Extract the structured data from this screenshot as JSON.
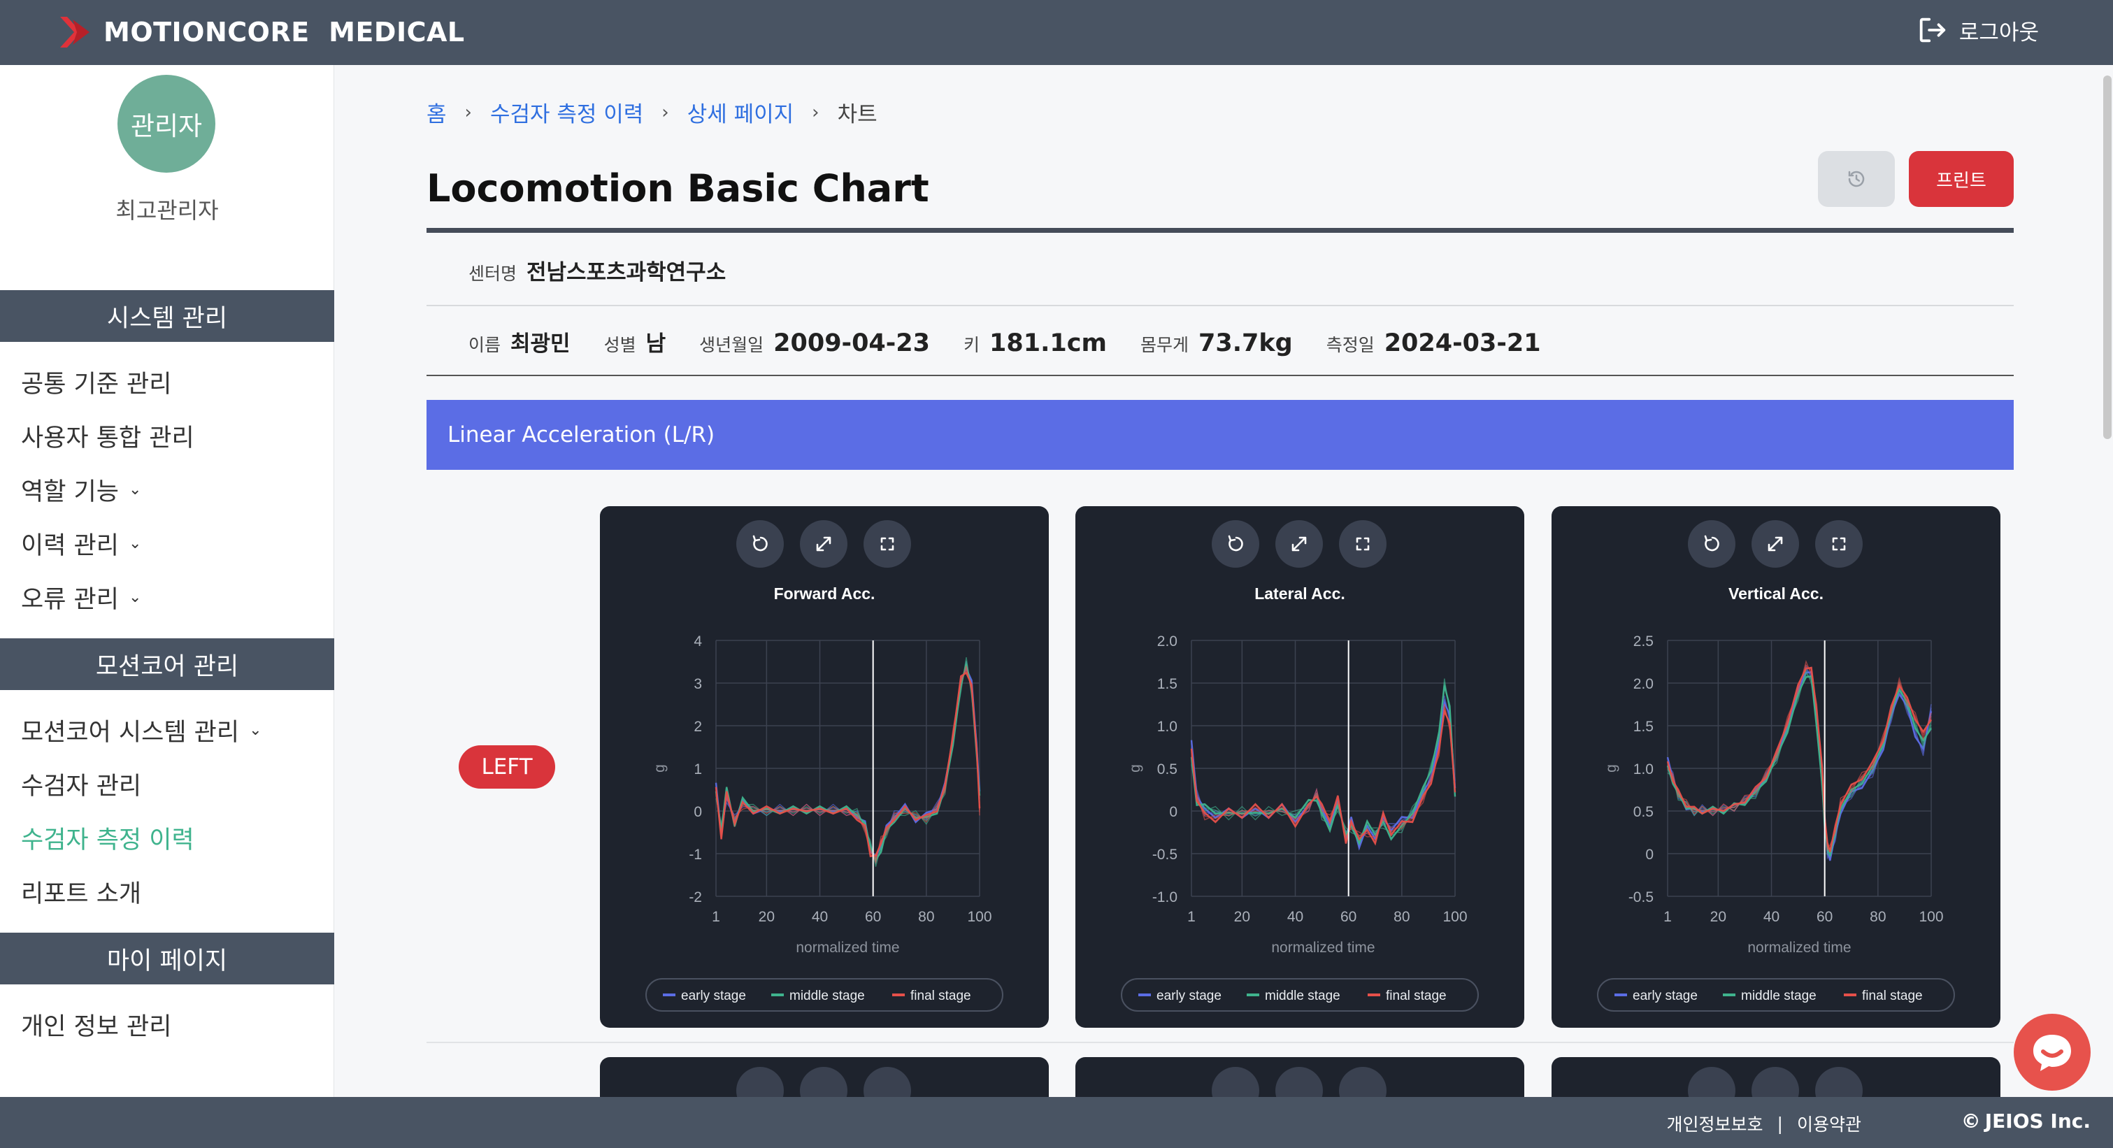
{
  "brand": {
    "name": "MOTIONCORE  MEDICAL"
  },
  "header": {
    "logout_label": "로그아웃"
  },
  "user": {
    "avatar_text": "관리자",
    "role": "최고관리자"
  },
  "sidebar": {
    "sections": [
      {
        "title": "시스템 관리",
        "items": [
          {
            "label": "공통 기준 관리",
            "has_submenu": false
          },
          {
            "label": "사용자 통합 관리",
            "has_submenu": false
          },
          {
            "label": "역할 기능",
            "has_submenu": true
          },
          {
            "label": "이력 관리",
            "has_submenu": true
          },
          {
            "label": "오류 관리",
            "has_submenu": true
          }
        ]
      },
      {
        "title": "모션코어 관리",
        "items": [
          {
            "label": "모션코어 시스템 관리",
            "has_submenu": true
          },
          {
            "label": "수검자 관리",
            "has_submenu": false
          },
          {
            "label": "수검자 측정 이력",
            "has_submenu": false,
            "active": true
          },
          {
            "label": "리포트 소개",
            "has_submenu": false
          }
        ]
      },
      {
        "title": "마이 페이지",
        "items": [
          {
            "label": "개인 정보 관리",
            "has_submenu": false
          }
        ]
      }
    ]
  },
  "breadcrumb": {
    "items": [
      "홈",
      "수검자 측정 이력",
      "상세 페이지"
    ],
    "current": "차트"
  },
  "page": {
    "title": "Locomotion Basic Chart",
    "print_label": "프린트"
  },
  "info": {
    "center_label": "센터명",
    "center_value": "전남스포츠과학연구소",
    "name_label": "이름",
    "name_value": "최광민",
    "sex_label": "성별",
    "sex_value": "남",
    "birth_label": "생년월일",
    "birth_value": "2009-04-23",
    "height_label": "키",
    "height_value": "181.1cm",
    "weight_label": "몸무게",
    "weight_value": "73.7kg",
    "date_label": "측정일",
    "date_value": "2024-03-21"
  },
  "section": {
    "title": "Linear Acceleration (L/R)",
    "side_badge": "LEFT"
  },
  "colors": {
    "early": "#5b6de5",
    "middle": "#3fb38d",
    "final": "#e6504a",
    "card_bg": "#1e232d",
    "accent_red": "#d9343b",
    "header_bg": "#495463"
  },
  "chart_data": [
    {
      "type": "line",
      "title": "Forward Acc.",
      "xlabel": "normalized time",
      "ylabel": "g",
      "xlim": [
        1,
        100
      ],
      "ylim": [
        -2,
        4
      ],
      "x_ticks": [
        1,
        20,
        40,
        60,
        80,
        100
      ],
      "y_ticks": [
        -2,
        -1,
        0,
        1,
        2,
        3,
        4
      ],
      "grid": true,
      "legend": "bottom",
      "marker_x": 60,
      "x": [
        1,
        3,
        5,
        8,
        11,
        15,
        20,
        25,
        30,
        35,
        40,
        45,
        50,
        54,
        57,
        59,
        61,
        63,
        65,
        68,
        72,
        76,
        80,
        84,
        87,
        90,
        93,
        95,
        97,
        99,
        100
      ],
      "series": [
        {
          "name": "early stage",
          "values": [
            0.6,
            -0.5,
            0.3,
            -0.2,
            0.2,
            0.0,
            0.0,
            0.05,
            0.0,
            0.05,
            0.0,
            0.05,
            0.0,
            -0.1,
            -0.3,
            -0.9,
            -1.1,
            -0.8,
            -0.4,
            -0.1,
            0.1,
            -0.2,
            -0.1,
            0.1,
            0.6,
            1.7,
            3.0,
            3.4,
            3.0,
            1.5,
            0.4
          ]
        },
        {
          "name": "middle stage",
          "values": [
            0.4,
            -0.4,
            0.5,
            -0.3,
            0.25,
            0.05,
            0.0,
            0.0,
            0.05,
            0.0,
            0.05,
            0.0,
            0.05,
            -0.05,
            -0.35,
            -0.8,
            -1.2,
            -0.9,
            -0.5,
            -0.2,
            0.0,
            -0.1,
            -0.2,
            0.0,
            0.5,
            1.6,
            2.9,
            3.5,
            2.8,
            1.3,
            0.3
          ]
        },
        {
          "name": "final stage",
          "values": [
            0.5,
            -0.6,
            0.4,
            -0.25,
            0.15,
            0.0,
            0.05,
            0.0,
            0.0,
            0.05,
            0.0,
            0.0,
            0.0,
            -0.15,
            -0.4,
            -1.0,
            -1.1,
            -0.7,
            -0.45,
            -0.15,
            0.05,
            -0.15,
            -0.15,
            0.05,
            0.55,
            1.8,
            3.1,
            3.3,
            2.9,
            1.4,
            0.0
          ]
        }
      ]
    },
    {
      "type": "line",
      "title": "Lateral Acc.",
      "xlabel": "normalized time",
      "ylabel": "g",
      "xlim": [
        1,
        100
      ],
      "ylim": [
        -1.0,
        2.0
      ],
      "x_ticks": [
        1,
        20,
        40,
        60,
        80,
        100
      ],
      "y_ticks": [
        -1.0,
        -0.5,
        0,
        0.5,
        1.0,
        1.5,
        2.0
      ],
      "grid": true,
      "legend": "bottom",
      "marker_x": 60,
      "x": [
        1,
        3,
        6,
        10,
        15,
        20,
        25,
        30,
        35,
        40,
        45,
        48,
        50,
        53,
        56,
        59,
        61,
        64,
        67,
        70,
        73,
        76,
        80,
        84,
        88,
        91,
        94,
        96,
        98,
        100
      ],
      "series": [
        {
          "name": "early stage",
          "values": [
            0.8,
            0.2,
            0.0,
            -0.05,
            0.0,
            -0.05,
            0.0,
            -0.05,
            0.05,
            -0.1,
            0.05,
            0.2,
            0.0,
            -0.15,
            0.1,
            -0.3,
            -0.1,
            -0.4,
            -0.2,
            -0.3,
            -0.1,
            -0.2,
            -0.1,
            -0.05,
            0.2,
            0.4,
            0.8,
            1.3,
            1.1,
            0.3
          ]
        },
        {
          "name": "middle stage",
          "values": [
            0.6,
            0.1,
            0.05,
            0.0,
            -0.05,
            0.0,
            -0.05,
            0.0,
            0.0,
            -0.05,
            0.1,
            0.15,
            -0.05,
            -0.2,
            0.05,
            -0.25,
            -0.2,
            -0.35,
            -0.15,
            -0.25,
            -0.15,
            -0.3,
            -0.2,
            0.0,
            0.25,
            0.5,
            0.9,
            1.5,
            1.2,
            0.2
          ]
        },
        {
          "name": "final stage",
          "values": [
            0.7,
            0.15,
            -0.05,
            -0.1,
            0.0,
            -0.05,
            0.05,
            -0.05,
            0.05,
            -0.15,
            0.05,
            0.2,
            0.05,
            -0.1,
            0.15,
            -0.35,
            -0.15,
            -0.3,
            -0.25,
            -0.35,
            -0.05,
            -0.25,
            -0.15,
            -0.1,
            0.15,
            0.35,
            0.7,
            1.2,
            1.0,
            0.25
          ]
        }
      ]
    },
    {
      "type": "line",
      "title": "Vertical Acc.",
      "xlabel": "normalized time",
      "ylabel": "g",
      "xlim": [
        1,
        100
      ],
      "ylim": [
        -0.5,
        2.5
      ],
      "x_ticks": [
        1,
        20,
        40,
        60,
        80,
        100
      ],
      "y_ticks": [
        -0.5,
        0,
        0.5,
        1.0,
        1.5,
        2.0,
        2.5
      ],
      "grid": true,
      "legend": "bottom",
      "marker_x": 60,
      "x": [
        1,
        3,
        5,
        8,
        11,
        14,
        18,
        22,
        26,
        30,
        34,
        38,
        42,
        46,
        50,
        53,
        55,
        57,
        59,
        60,
        61,
        62,
        64,
        66,
        70,
        74,
        78,
        82,
        85,
        88,
        91,
        94,
        97,
        100
      ],
      "series": [
        {
          "name": "early stage",
          "values": [
            1.1,
            0.9,
            0.7,
            0.55,
            0.5,
            0.52,
            0.5,
            0.52,
            0.55,
            0.62,
            0.72,
            0.9,
            1.15,
            1.5,
            1.9,
            2.15,
            2.1,
            1.6,
            0.9,
            0.4,
            0.0,
            -0.05,
            0.2,
            0.5,
            0.7,
            0.8,
            0.95,
            1.25,
            1.6,
            1.9,
            1.7,
            1.4,
            1.2,
            1.7
          ]
        },
        {
          "name": "middle stage",
          "values": [
            1.0,
            0.85,
            0.68,
            0.56,
            0.5,
            0.5,
            0.52,
            0.5,
            0.56,
            0.6,
            0.7,
            0.88,
            1.12,
            1.45,
            1.85,
            2.1,
            2.05,
            1.5,
            0.8,
            0.35,
            0.05,
            0.0,
            0.25,
            0.55,
            0.72,
            0.85,
            1.0,
            1.3,
            1.65,
            1.95,
            1.75,
            1.5,
            1.3,
            1.5
          ]
        },
        {
          "name": "final stage",
          "values": [
            1.05,
            0.88,
            0.72,
            0.58,
            0.52,
            0.5,
            0.5,
            0.53,
            0.55,
            0.63,
            0.75,
            0.92,
            1.18,
            1.55,
            1.95,
            2.2,
            2.15,
            1.7,
            1.0,
            0.45,
            0.1,
            0.05,
            0.3,
            0.6,
            0.78,
            0.9,
            1.05,
            1.35,
            1.7,
            2.0,
            1.8,
            1.6,
            1.4,
            1.6
          ]
        }
      ]
    }
  ],
  "footer": {
    "privacy_label": "개인정보보호",
    "terms_label": "이용약관",
    "copyright": "JEIOS Inc."
  }
}
